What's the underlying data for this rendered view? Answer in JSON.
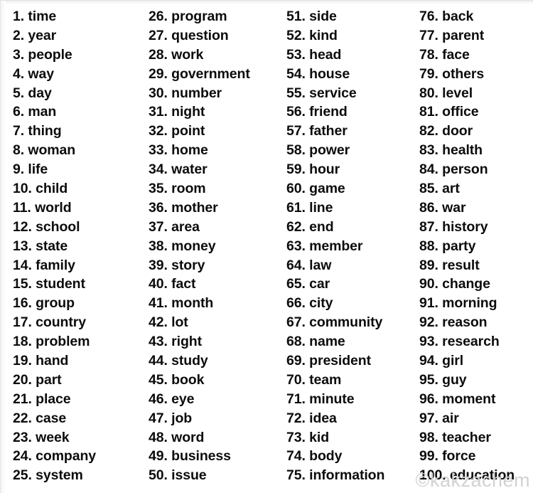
{
  "page": {
    "background_color": "#ffffff",
    "text_color": "#0c0c0c",
    "watermark_color": "#d2d2d2"
  },
  "watermark": {
    "text": "©kakzachem"
  },
  "columns": [
    {
      "name": "column-1",
      "entries": [
        {
          "number": "1.",
          "word": "time"
        },
        {
          "number": "2.",
          "word": "year"
        },
        {
          "number": "3.",
          "word": "people"
        },
        {
          "number": "4.",
          "word": "way"
        },
        {
          "number": "5.",
          "word": "day"
        },
        {
          "number": "6.",
          "word": "man"
        },
        {
          "number": "7.",
          "word": "thing"
        },
        {
          "number": "8.",
          "word": "woman"
        },
        {
          "number": "9.",
          "word": "life"
        },
        {
          "number": "10.",
          "word": "child"
        },
        {
          "number": "11.",
          "word": "world"
        },
        {
          "number": "12.",
          "word": "school"
        },
        {
          "number": "13.",
          "word": "state"
        },
        {
          "number": "14.",
          "word": "family"
        },
        {
          "number": "15.",
          "word": "student"
        },
        {
          "number": "16.",
          "word": "group"
        },
        {
          "number": "17.",
          "word": "country"
        },
        {
          "number": "18.",
          "word": "problem"
        },
        {
          "number": "19.",
          "word": "hand"
        },
        {
          "number": "20.",
          "word": "part"
        },
        {
          "number": "21.",
          "word": "place"
        },
        {
          "number": "22.",
          "word": "case"
        },
        {
          "number": "23.",
          "word": "week"
        },
        {
          "number": "24.",
          "word": "company"
        },
        {
          "number": "25.",
          "word": "system"
        }
      ]
    },
    {
      "name": "column-2",
      "entries": [
        {
          "number": "26.",
          "word": "program"
        },
        {
          "number": "27.",
          "word": "question"
        },
        {
          "number": "28.",
          "word": "work"
        },
        {
          "number": "29.",
          "word": "government"
        },
        {
          "number": "30.",
          "word": "number"
        },
        {
          "number": "31.",
          "word": "night"
        },
        {
          "number": "32.",
          "word": "point"
        },
        {
          "number": "33.",
          "word": "home"
        },
        {
          "number": "34.",
          "word": "water"
        },
        {
          "number": "35.",
          "word": "room"
        },
        {
          "number": "36.",
          "word": "mother"
        },
        {
          "number": "37.",
          "word": "area"
        },
        {
          "number": "38.",
          "word": "money"
        },
        {
          "number": "39.",
          "word": "story"
        },
        {
          "number": "40.",
          "word": "fact"
        },
        {
          "number": "41.",
          "word": "month"
        },
        {
          "number": "42.",
          "word": "lot"
        },
        {
          "number": "43.",
          "word": "right"
        },
        {
          "number": "44.",
          "word": "study"
        },
        {
          "number": "45.",
          "word": "book"
        },
        {
          "number": "46.",
          "word": "eye"
        },
        {
          "number": "47.",
          "word": "job"
        },
        {
          "number": "48.",
          "word": "word"
        },
        {
          "number": "49.",
          "word": "business"
        },
        {
          "number": "50.",
          "word": "issue"
        }
      ]
    },
    {
      "name": "column-3",
      "entries": [
        {
          "number": "51.",
          "word": "side"
        },
        {
          "number": "52.",
          "word": "kind"
        },
        {
          "number": "53.",
          "word": "head"
        },
        {
          "number": "54.",
          "word": "house"
        },
        {
          "number": "55.",
          "word": "service"
        },
        {
          "number": "56.",
          "word": "friend"
        },
        {
          "number": "57.",
          "word": "father"
        },
        {
          "number": "58.",
          "word": "power"
        },
        {
          "number": "59.",
          "word": "hour"
        },
        {
          "number": "60.",
          "word": "game"
        },
        {
          "number": "61.",
          "word": "line"
        },
        {
          "number": "62.",
          "word": "end"
        },
        {
          "number": "63.",
          "word": "member"
        },
        {
          "number": "64.",
          "word": "law"
        },
        {
          "number": "65.",
          "word": "car"
        },
        {
          "number": "66.",
          "word": "city"
        },
        {
          "number": "67.",
          "word": "community"
        },
        {
          "number": "68.",
          "word": "name"
        },
        {
          "number": "69.",
          "word": "president"
        },
        {
          "number": "70.",
          "word": "team"
        },
        {
          "number": "71.",
          "word": "minute"
        },
        {
          "number": "72.",
          "word": "idea"
        },
        {
          "number": "73.",
          "word": "kid"
        },
        {
          "number": "74.",
          "word": "body"
        },
        {
          "number": "75.",
          "word": "information"
        }
      ]
    },
    {
      "name": "column-4",
      "entries": [
        {
          "number": "76.",
          "word": "back"
        },
        {
          "number": "77.",
          "word": "parent"
        },
        {
          "number": "78.",
          "word": "face"
        },
        {
          "number": "79.",
          "word": "others"
        },
        {
          "number": "80.",
          "word": "level"
        },
        {
          "number": "81.",
          "word": "office"
        },
        {
          "number": "82.",
          "word": "door"
        },
        {
          "number": "83.",
          "word": "health"
        },
        {
          "number": "84.",
          "word": "person"
        },
        {
          "number": "85.",
          "word": "art"
        },
        {
          "number": "86.",
          "word": "war"
        },
        {
          "number": "87.",
          "word": "history"
        },
        {
          "number": "88.",
          "word": "party"
        },
        {
          "number": "89.",
          "word": "result"
        },
        {
          "number": "90.",
          "word": "change"
        },
        {
          "number": "91.",
          "word": "morning"
        },
        {
          "number": "92.",
          "word": "reason"
        },
        {
          "number": "93.",
          "word": "research"
        },
        {
          "number": "94.",
          "word": "girl"
        },
        {
          "number": "95.",
          "word": "guy"
        },
        {
          "number": "96.",
          "word": "moment"
        },
        {
          "number": "97.",
          "word": "air"
        },
        {
          "number": "98.",
          "word": "teacher"
        },
        {
          "number": "99.",
          "word": "force"
        },
        {
          "number": "100.",
          "word": "education"
        }
      ]
    }
  ]
}
